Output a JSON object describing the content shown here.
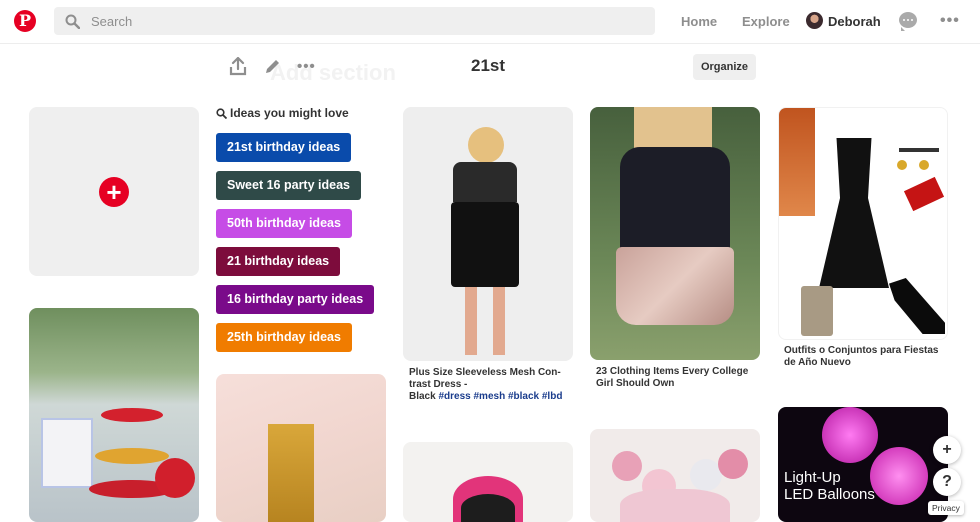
{
  "header": {
    "logo_letter": "P",
    "search_placeholder": "Search",
    "nav_home": "Home",
    "nav_explore": "Explore",
    "user_name": "Deborah",
    "more_glyph": "•••"
  },
  "board": {
    "ghost_text": "Add section",
    "title": "21st",
    "organize_label": "Organize",
    "toolbar_more": "•••"
  },
  "ideas": {
    "heading": "Ideas you might love",
    "items": [
      {
        "label": "21st birthday ideas",
        "color": "#0a4bab"
      },
      {
        "label": "Sweet 16 party ideas",
        "color": "#2f4a48"
      },
      {
        "label": "50th birthday ideas",
        "color": "#c64ce6"
      },
      {
        "label": "21 birthday ideas",
        "color": "#7d0c3c"
      },
      {
        "label": "16 birthday party ideas",
        "color": "#7a0a8a"
      },
      {
        "label": "25th birthday ideas",
        "color": "#f07c00"
      }
    ]
  },
  "pins": {
    "pin1_caption": "Plus Size Sleeveless Mesh Con-trast Dress -",
    "pin1_caption_tail": "Black",
    "pin1_tags": "#dress #mesh #black #lbd",
    "pin2_caption": "23 Clothing Items Every College Girl Should Own",
    "pin3_caption": "Outfits o Conjuntos para Fiestas de Año Nuevo",
    "pin4_overlay_line1": "Light-Up",
    "pin4_overlay_line2": "LED Balloons"
  },
  "floating": {
    "add_glyph": "+",
    "help_glyph": "?",
    "privacy_label": "Privacy"
  },
  "colors": {
    "brand": "#e60023",
    "tag_link": "#1a3c8c"
  }
}
